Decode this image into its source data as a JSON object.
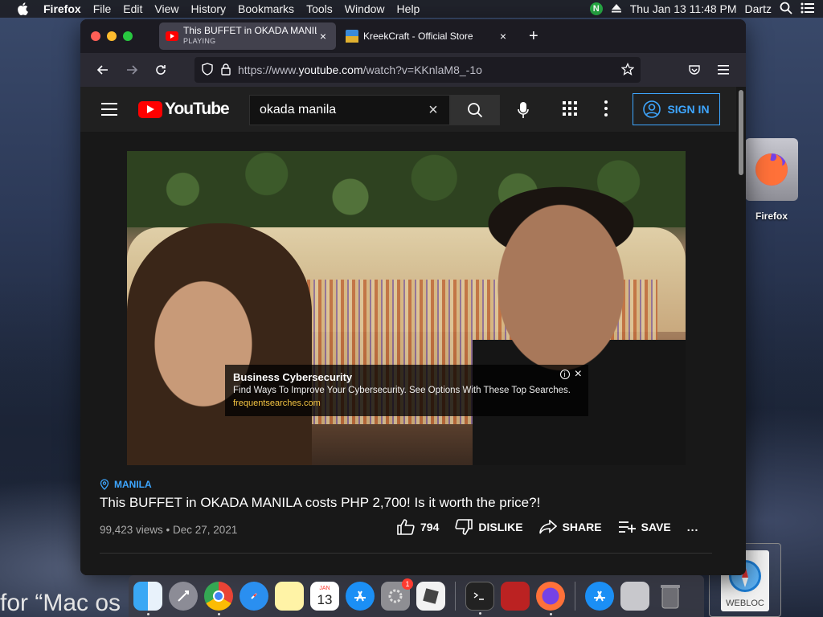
{
  "menubar": {
    "app_name": "Firefox",
    "items": [
      "File",
      "Edit",
      "View",
      "History",
      "Bookmarks",
      "Tools",
      "Window",
      "Help"
    ],
    "badge_letter": "N",
    "clock": "Thu Jan 13  11:48 PM",
    "user": "Dartz"
  },
  "tabs": [
    {
      "title": "This BUFFET in OKADA MANILA",
      "subtitle": "PLAYING",
      "close": "×"
    },
    {
      "title": "KreekCraft - Official Store",
      "close": "×"
    }
  ],
  "newtab_label": "+",
  "url": {
    "prefix": "https://www.",
    "host": "youtube.com",
    "path": "/watch?v=KKnlaM8_-1o"
  },
  "youtube": {
    "logo_text": "YouTube",
    "search_value": "okada manila",
    "clear": "×",
    "sign_in": "SIGN IN",
    "ad": {
      "title": "Business Cybersecurity",
      "description": "Find Ways To Improve Your Cybersecurity. See Options With These Top Searches.",
      "url": "frequentsearches.com",
      "info": "i",
      "close": "×"
    },
    "location": "MANILA",
    "video_title": "This BUFFET in OKADA MANILA costs PHP 2,700! Is it worth the price?!",
    "views": "99,423 views • Dec 27, 2021",
    "likes": "794",
    "dislike": "DISLIKE",
    "share": "SHARE",
    "save": "SAVE",
    "more": "..."
  },
  "desktop": {
    "firefox_label": "Firefox",
    "webloc_label": "WEBLOC",
    "wallpaper_text": "for “Mac os"
  },
  "dock": {
    "calendar_month": "JAN",
    "calendar_day": "13",
    "prefs_badge": "1"
  },
  "colors": {
    "yt_red": "#ff0000",
    "link_blue": "#3ea6ff",
    "ad_url": "#f5c542"
  }
}
